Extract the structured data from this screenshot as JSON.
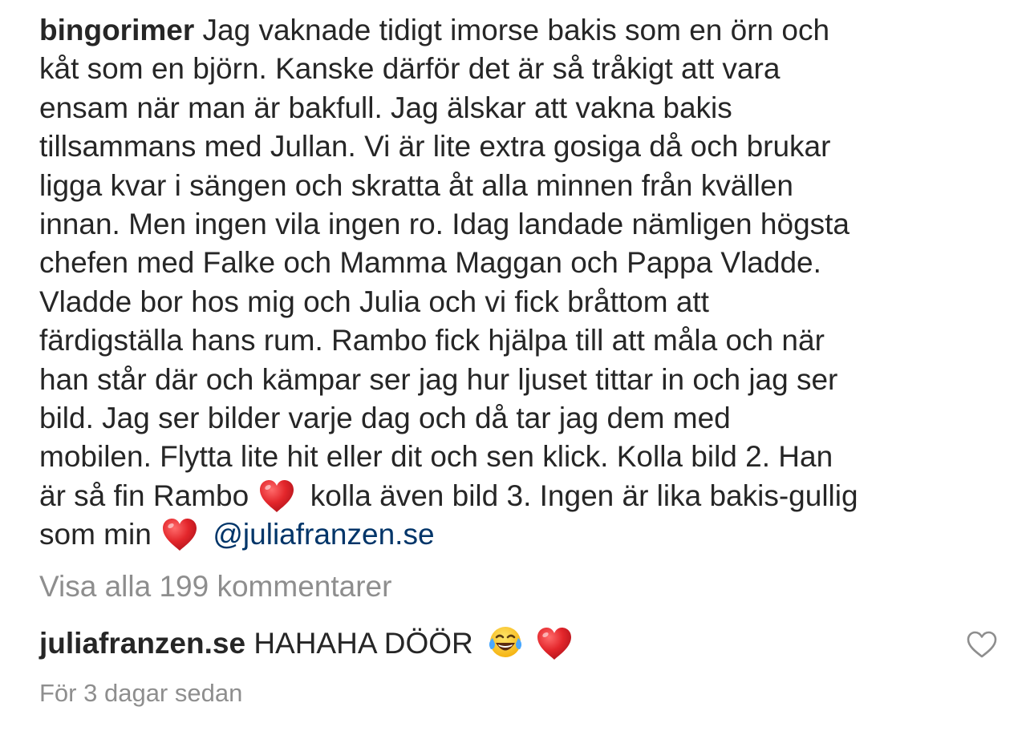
{
  "post": {
    "username": "bingorimer",
    "caption_lines": [
      "Jag vaknade tidigt imorse bakis som en örn och",
      "kåt som en björn. Kanske därför det är så tråkigt att vara",
      "ensam när man är bakfull. Jag älskar att vakna bakis",
      "tillsammans med Jullan. Vi är lite extra gosiga då och brukar",
      "ligga kvar i sängen och skratta åt alla minnen från kvällen",
      "innan. Men ingen vila ingen ro. Idag landade nämligen högsta",
      "chefen med Falke och Mamma Maggan och Pappa Vladde.",
      "Vladde bor hos mig och Julia och vi fick bråttom att",
      "färdigställa hans rum. Rambo fick hjälpa till att måla och när",
      "han står där och kämpar ser jag hur ljuset tittar in och jag ser",
      "bild. Jag ser bilder varje dag och då tar jag dem med",
      "mobilen. Flytta lite hit eller dit och sen klick. Kolla bild 2. Han"
    ],
    "line13_before": "är så fin Rambo",
    "line13_after": "kolla även bild 3. Ingen är lika bakis-gullig",
    "line14_before": "som min",
    "mention": "@juliafranzen.se",
    "heart_icon": "red-heart-emoji",
    "heart_color": "#e3262b",
    "mention_color": "#003569"
  },
  "comments_link": {
    "label": "Visa alla 199 kommentarer"
  },
  "comment": {
    "username": "juliafranzen.se",
    "text": "HAHAHA DÖÖR",
    "emojis": [
      "face-with-tears-of-joy-emoji",
      "red-heart-emoji"
    ],
    "like_icon": "heart-outline-icon"
  },
  "timestamp": "För 3 dagar sedan"
}
